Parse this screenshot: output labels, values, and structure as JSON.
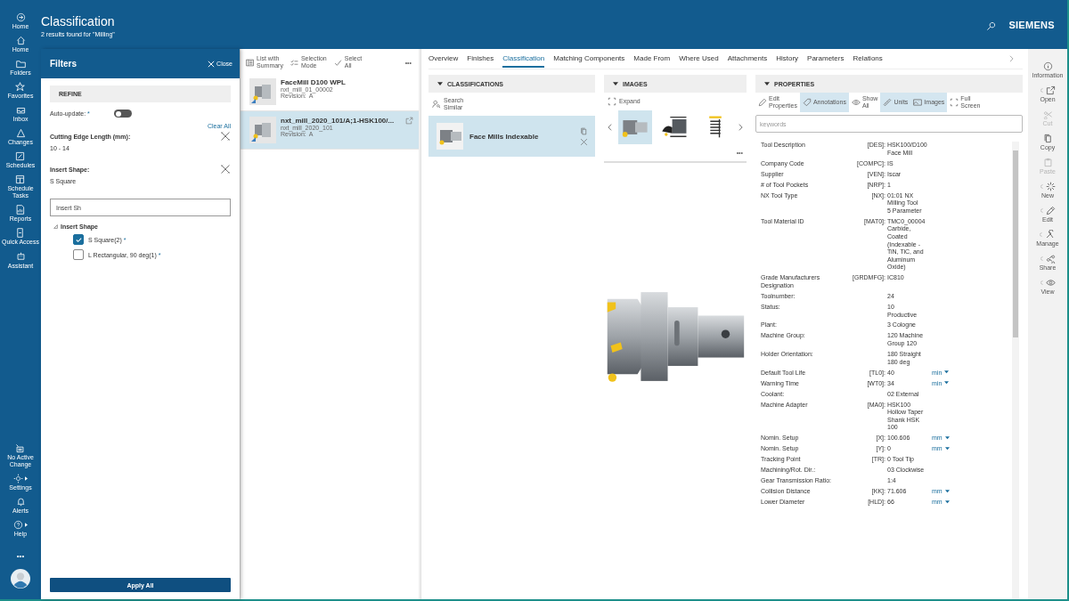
{
  "header": {
    "title": "Classification",
    "subtitle": "2 results found for \"Milling\"",
    "brand": "SIEMENS"
  },
  "nav": {
    "top": [
      {
        "label": "Home"
      },
      {
        "label": "Home"
      },
      {
        "label": "Folders"
      },
      {
        "label": "Favorites"
      },
      {
        "label": "Inbox"
      },
      {
        "label": "Changes"
      },
      {
        "label": "Schedules"
      },
      {
        "label": "Schedule\nTasks"
      },
      {
        "label": "Reports"
      },
      {
        "label": "Quick Access"
      },
      {
        "label": "Assistant"
      }
    ],
    "bottom": [
      {
        "label": "No Active\nChange",
        "submenu": false
      },
      {
        "label": "Settings",
        "submenu": true
      },
      {
        "label": "Alerts",
        "submenu": false
      },
      {
        "label": "Help",
        "submenu": true
      }
    ],
    "more": "•••"
  },
  "filters": {
    "title": "Filters",
    "close": "Close",
    "section": "REFINE",
    "auto_update": {
      "label": "Auto-update:",
      "mark": "*",
      "on": false
    },
    "clear_all": "Clear All",
    "criteria": [
      {
        "label": "Cutting Edge Length (mm):",
        "value": "10 - 14"
      },
      {
        "label": "Insert Shape:",
        "value": "S Square"
      }
    ],
    "search": {
      "value": "Insert Sh"
    },
    "tree": {
      "label": "Insert Shape",
      "expanded": true,
      "children": [
        {
          "label": "S Square(2)",
          "mark": "*",
          "checked": true
        },
        {
          "label": "L Rectangular, 90 deg(1)",
          "mark": "*",
          "checked": false
        }
      ]
    },
    "apply": "Apply All"
  },
  "list": {
    "toolbar": [
      {
        "label": "List with\nSummary"
      },
      {
        "label": "Selection\nMode"
      },
      {
        "label": "Select\nAll"
      }
    ],
    "more": "•••",
    "items": [
      {
        "title": "FaceMill D100 WPL",
        "id": "nxt_mill_01_00002",
        "revision_label": "Revision:",
        "revision": "A",
        "selected": false,
        "open_icon": false
      },
      {
        "title": "nxt_mill_2020_101/A;1-HSK100/...",
        "id": "nxt_mill_2020_101",
        "revision_label": "Revision:",
        "revision": "A",
        "selected": true,
        "open_icon": true
      }
    ]
  },
  "tabs": [
    {
      "label": "Overview",
      "selected": false
    },
    {
      "label": "Finishes",
      "selected": false
    },
    {
      "label": "Classification",
      "selected": true
    },
    {
      "label": "Matching Components",
      "selected": false
    },
    {
      "label": "Made From",
      "selected": false
    },
    {
      "label": "Where Used",
      "selected": false
    },
    {
      "label": "Attachments",
      "selected": false
    },
    {
      "label": "History",
      "selected": false
    },
    {
      "label": "Parameters",
      "selected": false
    },
    {
      "label": "Relations",
      "selected": false
    }
  ],
  "classifications": {
    "header": "CLASSIFICATIONS",
    "action": "Search\nSimilar",
    "card": {
      "label": "Face Mills Indexable",
      "selected": true
    }
  },
  "images": {
    "header": "IMAGES",
    "action": "Expand",
    "more": "•••",
    "thumbnails": [
      {
        "kind": "photo",
        "selected": true
      },
      {
        "kind": "drawing",
        "selected": false
      },
      {
        "kind": "sheet",
        "selected": false
      }
    ]
  },
  "properties": {
    "header": "PROPERTIES",
    "placeholder": "keywords",
    "toolbar": [
      {
        "label": "Edit\nProperties",
        "selected": false
      },
      {
        "label": "Annotations",
        "selected": true
      },
      {
        "label": "Show\nAll",
        "selected": false
      },
      {
        "label": "Units",
        "selected": true
      },
      {
        "label": "Images",
        "selected": true
      },
      {
        "label": "Full\nScreen",
        "selected": false
      }
    ],
    "rows": [
      {
        "label": "Tool Description",
        "code": "[DES]:",
        "value": [
          "HSK100/D100",
          "Face Mill"
        ]
      },
      {
        "label": "Company Code",
        "code": "[COMPC]:",
        "value": [
          "IS"
        ]
      },
      {
        "label": "Supplier",
        "code": "[VEN]:",
        "value": [
          "Iscar"
        ]
      },
      {
        "label": "# of Tool Pockets",
        "code": "[NRP]:",
        "value": [
          "1"
        ]
      },
      {
        "label": "NX Tool Type",
        "code": "[NX]:",
        "value": [
          "01:01 NX",
          "Milling Tool",
          "5 Parameter"
        ]
      },
      {
        "label": "Tool Material ID",
        "code": "[MAT0]:",
        "value": [
          "TMC0_00004",
          "Carbide,",
          "Coated",
          "(Indexable -",
          "TiN, TiC, and",
          "Aluminum",
          "Oxide)"
        ]
      },
      {
        "label": "Grade Manufacturers Designation",
        "code": "[GRDMFG]:",
        "value": [
          "IC810"
        ]
      },
      {
        "label": "Toolnumber:",
        "value": [
          "24"
        ]
      },
      {
        "label": "Status:",
        "value": [
          "10",
          "Productive"
        ]
      },
      {
        "label": "Plant:",
        "value": [
          "3 Cologne"
        ]
      },
      {
        "label": "Machine Group:",
        "value": [
          "120 Machine",
          "Group 120"
        ]
      },
      {
        "label": "Holder Orientation:",
        "value": [
          "180 Straight",
          "180 deg"
        ]
      },
      {
        "label": "Default Tool Life",
        "code": "[TL0]:",
        "value": [
          "40"
        ],
        "unit": "min"
      },
      {
        "label": "Warning Time",
        "code": "[WT0]:",
        "value": [
          "34"
        ],
        "unit": "min"
      },
      {
        "label": "Coolant:",
        "value": [
          "02 External"
        ]
      },
      {
        "label": "Machine Adapter",
        "code": "[MA0]:",
        "value": [
          "HSK100",
          "Hollow Taper",
          "Shank HSK",
          "100"
        ]
      },
      {
        "label": "Nomin. Setup",
        "code": "[X]:",
        "value": [
          "100.606"
        ],
        "unit": "mm"
      },
      {
        "label": "Nomin. Setup",
        "code": "[Y]:",
        "value": [
          "0"
        ],
        "unit": "mm"
      },
      {
        "label": "Tracking Point",
        "code": "[TR]:",
        "value": [
          "0 Tool Tip"
        ]
      },
      {
        "label": "Machining/Rot. Dir.:",
        "value": [
          "03 Clockwise"
        ]
      },
      {
        "label": "Gear Transmission Ratio:",
        "value": [
          "1:4"
        ]
      },
      {
        "label": "Collision Distance",
        "code": "[KK]:",
        "value": [
          "71.606"
        ],
        "unit": "mm"
      },
      {
        "label": "Lower Diameter",
        "code": "[HLD]:",
        "value": [
          "66"
        ],
        "unit": "mm"
      }
    ]
  },
  "commands": [
    {
      "label": "Information",
      "disabled": false,
      "submenu": false
    },
    {
      "label": "Open",
      "disabled": false,
      "submenu": true
    },
    {
      "label": "Cut",
      "disabled": true,
      "submenu": false
    },
    {
      "label": "Copy",
      "disabled": false,
      "submenu": false
    },
    {
      "label": "Paste",
      "disabled": true,
      "submenu": false
    },
    {
      "label": "New",
      "disabled": false,
      "submenu": true
    },
    {
      "label": "Edit",
      "disabled": false,
      "submenu": true
    },
    {
      "label": "Manage",
      "disabled": false,
      "submenu": true
    },
    {
      "label": "Share",
      "disabled": false,
      "submenu": true
    },
    {
      "label": "View",
      "disabled": false,
      "submenu": true
    }
  ]
}
